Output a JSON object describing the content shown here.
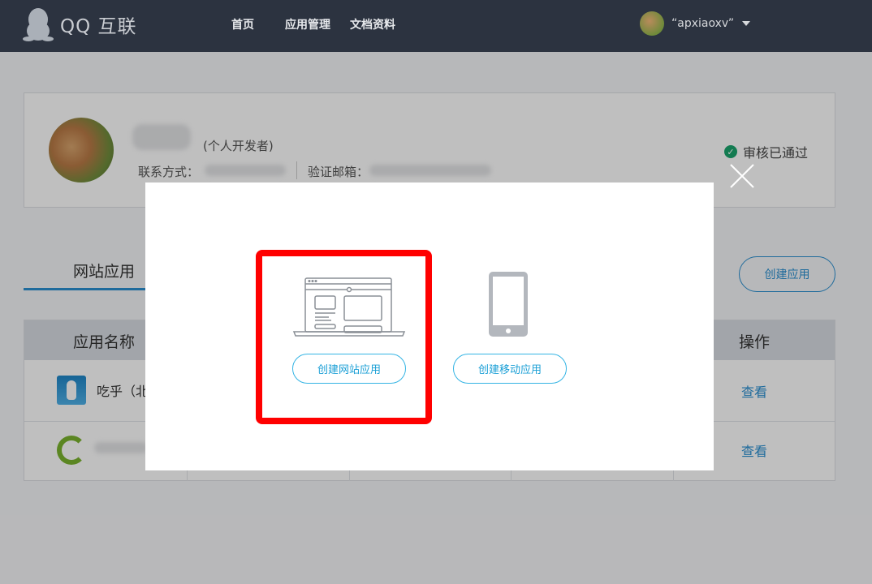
{
  "header": {
    "logo_text": "QQ 互联",
    "nav": [
      "首页",
      "应用管理",
      "文档资料"
    ],
    "username": "“apxiaoxv”"
  },
  "profile": {
    "dev_type": "(个人开发者)",
    "contact_label": "联系方式：",
    "email_label": "验证邮箱：",
    "status": "审核已通过"
  },
  "apps": {
    "tab_label": "网站应用",
    "create_button": "创建应用",
    "col_name": "应用名称",
    "col_op": "操作",
    "rows": [
      {
        "name": "吃乎（北",
        "action": "查看"
      },
      {
        "name": "",
        "action": "查看"
      }
    ]
  },
  "dialog": {
    "web_button": "创建网站应用",
    "mobile_button": "创建移动应用"
  },
  "colors": {
    "accent": "#2a8fd1",
    "highlight": "#ff0000",
    "nav_bg": "#2c3340",
    "verified": "#1aa56d"
  }
}
